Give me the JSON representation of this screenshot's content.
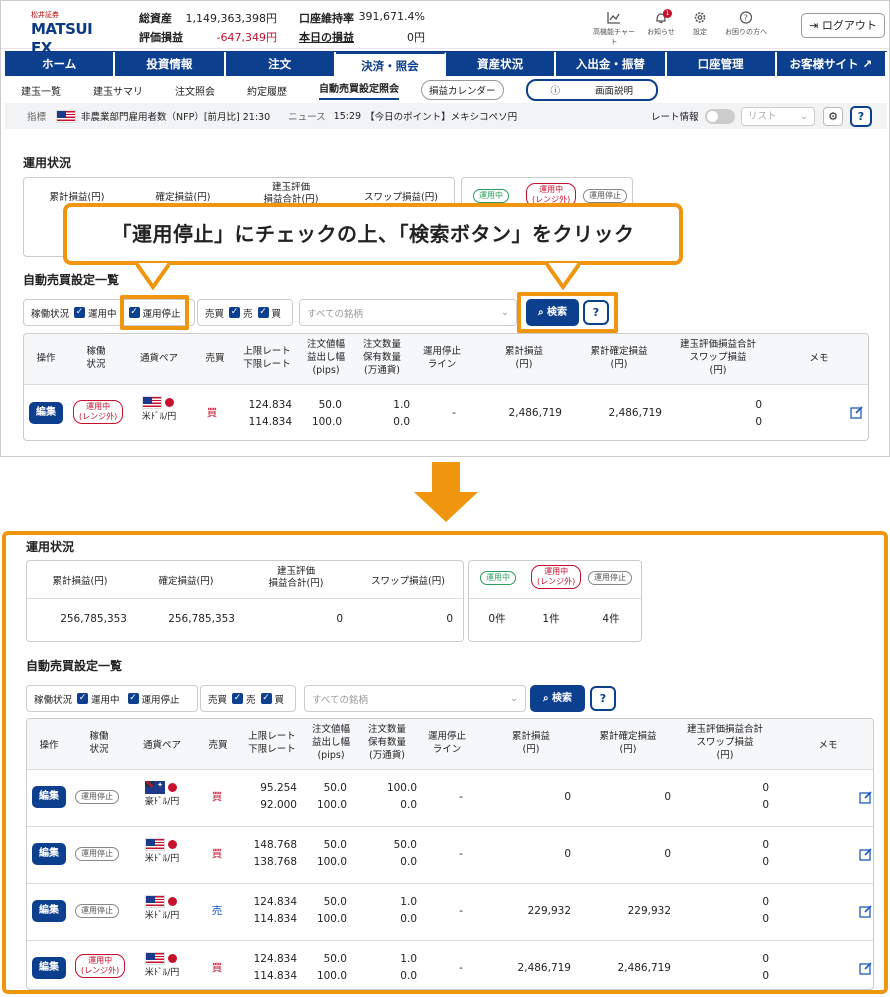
{
  "top": {
    "logo_small": "松井証券",
    "logo_big": "MATSUI",
    "logo_fx": "FX",
    "total_assets_label": "総資産",
    "total_assets": "1,149,363,398円",
    "unrealized_label": "評価損益",
    "unrealized": "-647,349円",
    "margin_ratio_label": "口座維持率",
    "margin_ratio": "391,671.4%",
    "today_pl_label": "本日の損益",
    "today_pl": "0円",
    "icons": [
      {
        "name": "高機能チャート"
      },
      {
        "name": "お知らせ",
        "badge": "1"
      },
      {
        "name": "設定"
      },
      {
        "name": "お困りの方へ"
      }
    ],
    "logout": "ログアウト"
  },
  "nav": [
    "ホーム",
    "投資情報",
    "注文",
    "決済・照会",
    "資産状況",
    "入出金・振替",
    "口座管理",
    "お客様サイト"
  ],
  "subnav": [
    "建玉一覧",
    "建玉サマリ",
    "注文照会",
    "約定履歴",
    "自動売買設定照会"
  ],
  "subnav_btn1": "損益カレンダー",
  "subnav_btn2": "画面説明",
  "news": {
    "indicator_label": "指標",
    "indicator": "非農業部門雇用者数（NFP）[前月比] 21:30",
    "news_label": "ニュース",
    "news_time": "15:29",
    "news_text": "【今日のポイント】メキシコペソ円",
    "rate_label": "レート情報",
    "list": "リスト"
  },
  "callout": "「運用停止」にチェックの上、「検索ボタン」をクリック",
  "status_title": "運用状況",
  "status_headers": [
    "累計損益(円)",
    "確定損益(円)",
    "建玉評価\n損益合計(円)",
    "スワップ損益(円)"
  ],
  "tags": {
    "running": "運用中",
    "running_out": "運用中",
    "running_out_sub": "(レンジ外)",
    "stopped": "運用停止"
  },
  "list_title": "自動売買設定一覧",
  "filter": {
    "label": "稼働状況",
    "running": "運用中",
    "stopped": "運用停止",
    "side_label": "売買",
    "sell": "売",
    "buy": "買",
    "placeholder": "すべての銘柄",
    "search": "検索",
    "help": "?"
  },
  "headers": [
    "操作",
    "稼働\n状況",
    "通貨ペア",
    "売買",
    "上限レート\n下限レート",
    "注文値幅\n益出し幅\n(pips)",
    "注文数量\n保有数量\n(万通貨)",
    "運用停止\nライン",
    "累計損益\n(円)",
    "累計確定損益\n(円)",
    "建玉評価損益合計\nスワップ損益\n(円)",
    "メモ"
  ],
  "top_row": {
    "edit": "編集",
    "status": "運用中",
    "status_sub": "(レンジ外)",
    "pair": "米ﾄﾞﾙ/円",
    "side": "買",
    "upper": "124.834",
    "lower": "114.834",
    "width": "50.0",
    "take": "100.0",
    "qty": "1.0",
    "hold": "0.0",
    "stop": "-",
    "cum": "2,486,719",
    "cumfix": "2,486,719",
    "eval": "0",
    "swap": "0"
  },
  "after": {
    "status_values": [
      "256,785,353",
      "256,785,353",
      "0",
      "0"
    ],
    "counts": [
      "0件",
      "1件",
      "4件"
    ],
    "rows": [
      {
        "edit": "編集",
        "status": "運用停止",
        "status_sub": "",
        "flag": "au",
        "pair": "豪ﾄﾞﾙ/円",
        "side": "買",
        "upper": "95.254",
        "lower": "92.000",
        "width": "50.0",
        "take": "100.0",
        "qty": "100.0",
        "hold": "0.0",
        "stop": "-",
        "cum": "0",
        "cumfix": "0",
        "eval": "0",
        "swap": "0"
      },
      {
        "edit": "編集",
        "status": "運用停止",
        "status_sub": "",
        "flag": "us",
        "pair": "米ﾄﾞﾙ/円",
        "side": "買",
        "upper": "148.768",
        "lower": "138.768",
        "width": "50.0",
        "take": "100.0",
        "qty": "50.0",
        "hold": "0.0",
        "stop": "-",
        "cum": "0",
        "cumfix": "0",
        "eval": "0",
        "swap": "0"
      },
      {
        "edit": "編集",
        "status": "運用停止",
        "status_sub": "",
        "flag": "us",
        "pair": "米ﾄﾞﾙ/円",
        "side": "売",
        "upper": "124.834",
        "lower": "114.834",
        "width": "50.0",
        "take": "100.0",
        "qty": "1.0",
        "hold": "0.0",
        "stop": "-",
        "cum": "229,932",
        "cumfix": "229,932",
        "eval": "0",
        "swap": "0"
      },
      {
        "edit": "編集",
        "status": "運用中",
        "status_sub": "(レンジ外)",
        "flag": "us",
        "pair": "米ﾄﾞﾙ/円",
        "side": "買",
        "upper": "124.834",
        "lower": "114.834",
        "width": "50.0",
        "take": "100.0",
        "qty": "1.0",
        "hold": "0.0",
        "stop": "-",
        "cum": "2,486,719",
        "cumfix": "2,486,719",
        "eval": "0",
        "swap": "0"
      }
    ]
  },
  "colors": {
    "brand": "#0d3f8f",
    "accent": "#f0960e",
    "loss": "#c8102e",
    "buy": "#c8102e",
    "sell": "#1d5bbf"
  }
}
